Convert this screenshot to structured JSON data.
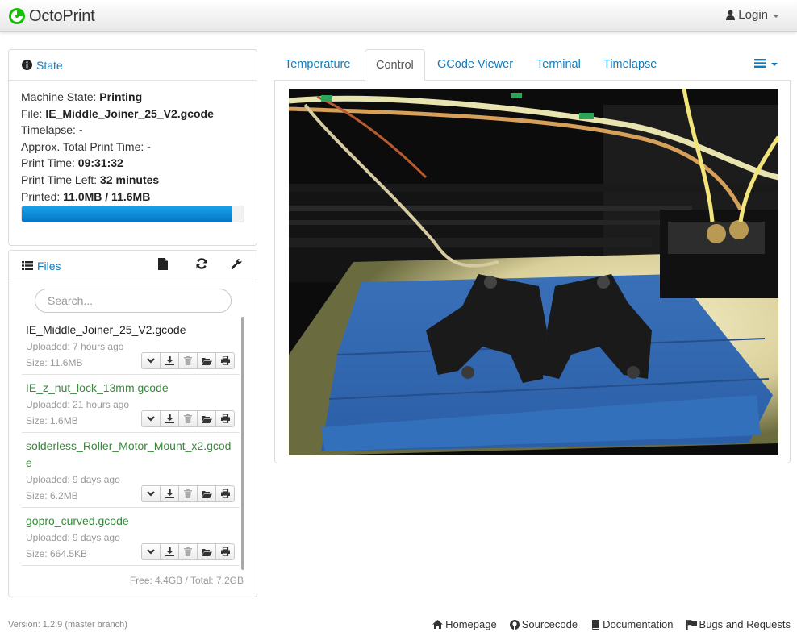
{
  "navbar": {
    "brand": "OctoPrint",
    "login_label": "Login",
    "icons": {
      "brand": "octoprint-logo",
      "login": "user-icon",
      "login_caret": "caret-down-icon"
    }
  },
  "state": {
    "title": "State",
    "icon": "info-circle-icon",
    "machine_state_label": "Machine State:",
    "machine_state": "Printing",
    "file_label": "File:",
    "file": "IE_Middle_Joiner_25_V2.gcode",
    "timelapse_label": "Timelapse:",
    "timelapse": "-",
    "approx_label": "Approx. Total Print Time:",
    "approx": "-",
    "print_time_label": "Print Time:",
    "print_time": "09:31:32",
    "time_left_label": "Print Time Left:",
    "time_left": "32 minutes",
    "printed_label": "Printed:",
    "printed": "11.0MB / 11.6MB",
    "progress_fraction": 0.948
  },
  "files": {
    "title": "Files",
    "icons": {
      "header": "list-icon",
      "upload": "file-icon",
      "refresh": "refresh-icon",
      "settings": "wrench-icon",
      "actions": [
        "chevron-down-icon",
        "download-icon",
        "trash-icon",
        "folder-open-icon",
        "print-icon"
      ]
    },
    "search_placeholder": "Search...",
    "items": [
      {
        "name": "IE_Middle_Joiner_25_V2.gcode",
        "uploaded": "Uploaded: 7 hours ago",
        "size": "Size: 11.6MB",
        "status": "selected"
      },
      {
        "name": "IE_z_nut_lock_13mm.gcode",
        "uploaded": "Uploaded: 21 hours ago",
        "size": "Size: 1.6MB",
        "status": "printed"
      },
      {
        "name": "solderless_Roller_Motor_Mount_x2.gcode",
        "uploaded": "Uploaded: 9 days ago",
        "size": "Size: 6.2MB",
        "status": "printed"
      },
      {
        "name": "gopro_curved.gcode",
        "uploaded": "Uploaded: 9 days ago",
        "size": "Size: 664.5KB",
        "status": "printed"
      }
    ],
    "free_total": "Free: 4.4GB / Total: 7.2GB",
    "colors": {
      "printed": "#38893a",
      "link": "#0f7cc0"
    }
  },
  "tabs": {
    "items": [
      "Temperature",
      "Control",
      "GCode Viewer",
      "Terminal",
      "Timelapse"
    ],
    "active": "Control",
    "menu_icon": "list-icon"
  },
  "webcam": {
    "description_icon": "webcam-stream"
  },
  "footer": {
    "version": "Version: 1.2.9 (master branch)",
    "links": [
      {
        "label": "Homepage",
        "icon": "home-icon"
      },
      {
        "label": "Sourcecode",
        "icon": "github-icon"
      },
      {
        "label": "Documentation",
        "icon": "book-icon"
      },
      {
        "label": "Bugs and Requests",
        "icon": "flag-icon"
      }
    ]
  }
}
